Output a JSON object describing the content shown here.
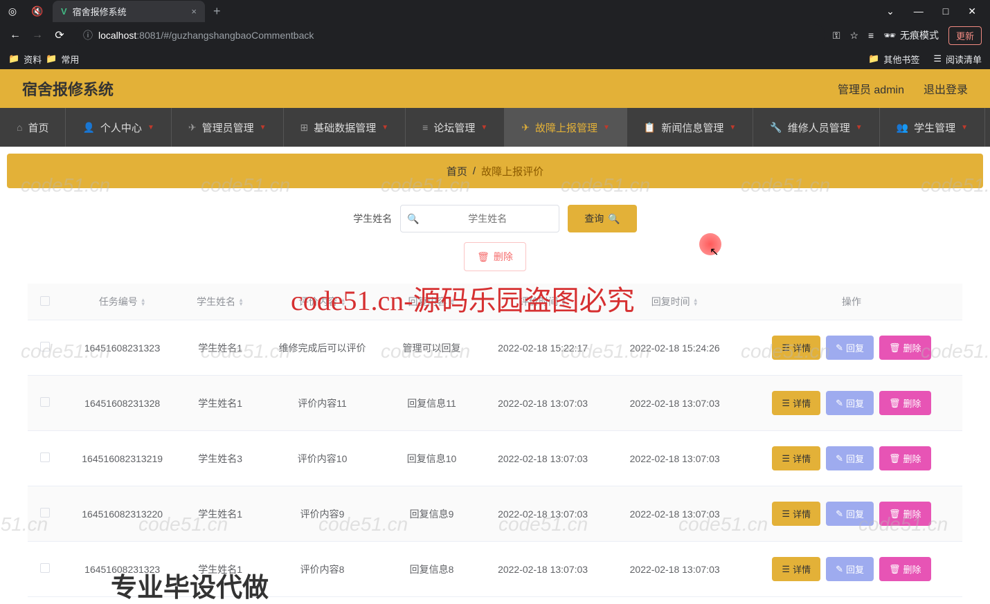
{
  "browser": {
    "tab_title": "宿舍报修系统",
    "url_host": "localhost",
    "url_port": ":8081",
    "url_path": "/#/guzhangshangbaoCommentback",
    "incognito": "无痕模式",
    "update": "更新",
    "bookmarks": {
      "left1": "资料",
      "left2": "常用",
      "right1": "其他书签",
      "right2": "阅读清单"
    }
  },
  "app": {
    "title": "宿舍报修系统",
    "user_role": "管理员",
    "username": "admin",
    "logout": "退出登录"
  },
  "menu": [
    {
      "label": "首页",
      "caret": false
    },
    {
      "label": "个人中心",
      "caret": true
    },
    {
      "label": "管理员管理",
      "caret": true
    },
    {
      "label": "基础数据管理",
      "caret": true
    },
    {
      "label": "论坛管理",
      "caret": true
    },
    {
      "label": "故障上报管理",
      "caret": true,
      "active": true
    },
    {
      "label": "新闻信息管理",
      "caret": true
    },
    {
      "label": "维修人员管理",
      "caret": true
    },
    {
      "label": "学生管理",
      "caret": true
    }
  ],
  "breadcrumb": {
    "home": "首页",
    "current": "故障上报评价"
  },
  "search": {
    "label": "学生姓名",
    "placeholder": "学生姓名",
    "button": "查询"
  },
  "delete_btn": "删除",
  "columns": [
    "任务编号",
    "学生姓名",
    "评价内容",
    "回复内容",
    "评价时间",
    "回复时间",
    "操作"
  ],
  "action_labels": {
    "detail": "详情",
    "reply": "回复",
    "delete": "删除"
  },
  "rows": [
    {
      "id": "1645160823132З",
      "name": "学生姓名1",
      "eval": "维修完成后可以评价",
      "reply": "管理可以回复",
      "etime": "2022-02-18 15:22:17",
      "rtime": "2022-02-18 15:24:26"
    },
    {
      "id": "16451608231328",
      "name": "学生姓名1",
      "eval": "评价内容11",
      "reply": "回复信息11",
      "etime": "2022-02-18 13:07:03",
      "rtime": "2022-02-18 13:07:03"
    },
    {
      "id": "164516082313219",
      "name": "学生姓名3",
      "eval": "评价内容10",
      "reply": "回复信息10",
      "etime": "2022-02-18 13:07:03",
      "rtime": "2022-02-18 13:07:03"
    },
    {
      "id": "164516082313220",
      "name": "学生姓名1",
      "eval": "评价内容9",
      "reply": "回复信息9",
      "etime": "2022-02-18 13:07:03",
      "rtime": "2022-02-18 13:07:03"
    },
    {
      "id": "16451608231323",
      "name": "学生姓名1",
      "eval": "评价内容8",
      "reply": "回复信息8",
      "etime": "2022-02-18 13:07:03",
      "rtime": "2022-02-18 13:07:03"
    }
  ],
  "watermarks": {
    "red": "code51.cn-源码乐园盗图必究",
    "bottom": "专业毕设代做",
    "gray": "code51.cn"
  }
}
